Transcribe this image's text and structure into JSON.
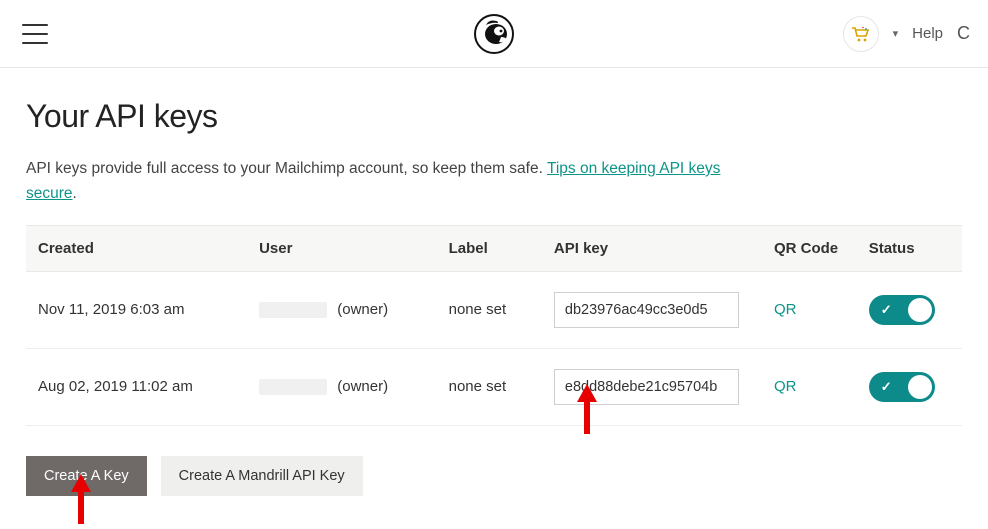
{
  "header": {
    "help_label": "Help",
    "edge_char": "C"
  },
  "page": {
    "title": "Your API keys",
    "desc_part1": "API keys provide full access to your Mailchimp account, so keep them safe. ",
    "tips_link_text": "Tips on keeping API keys secure",
    "desc_tail": "."
  },
  "table": {
    "headers": {
      "created": "Created",
      "user": "User",
      "label": "Label",
      "apikey": "API key",
      "qr": "QR Code",
      "status": "Status"
    },
    "rows": [
      {
        "created": "Nov 11, 2019 6:03 am",
        "user_role": "(owner)",
        "label": "none set",
        "key": "db23976ac49cc3e0d5",
        "qr": "QR"
      },
      {
        "created": "Aug 02, 2019 11:02 am",
        "user_role": "(owner)",
        "label": "none set",
        "key": "e8dd88debe21c95704b",
        "qr": "QR"
      }
    ]
  },
  "actions": {
    "create_key": "Create A Key",
    "create_mandrill": "Create A Mandrill API Key"
  }
}
